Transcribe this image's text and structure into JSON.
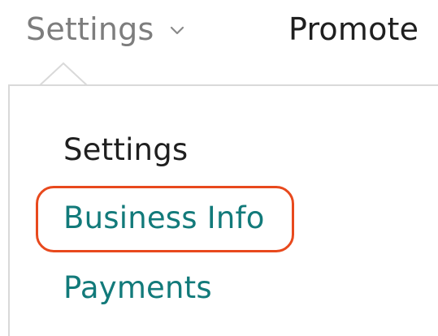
{
  "nav": {
    "settings_label": "Settings",
    "settings_chevron_icon": "chevron-down-icon",
    "promote_label": "Promote"
  },
  "dropdown": {
    "heading": "Settings",
    "items": [
      {
        "label": "Business Info",
        "highlighted": true
      },
      {
        "label": "Payments",
        "highlighted": false
      }
    ]
  },
  "colors": {
    "link": "#127a7a",
    "heading": "#1f1f1f",
    "nav_inactive": "#7d7d7d",
    "highlight_ring": "#e8491d",
    "divider": "#d9d9d9"
  }
}
